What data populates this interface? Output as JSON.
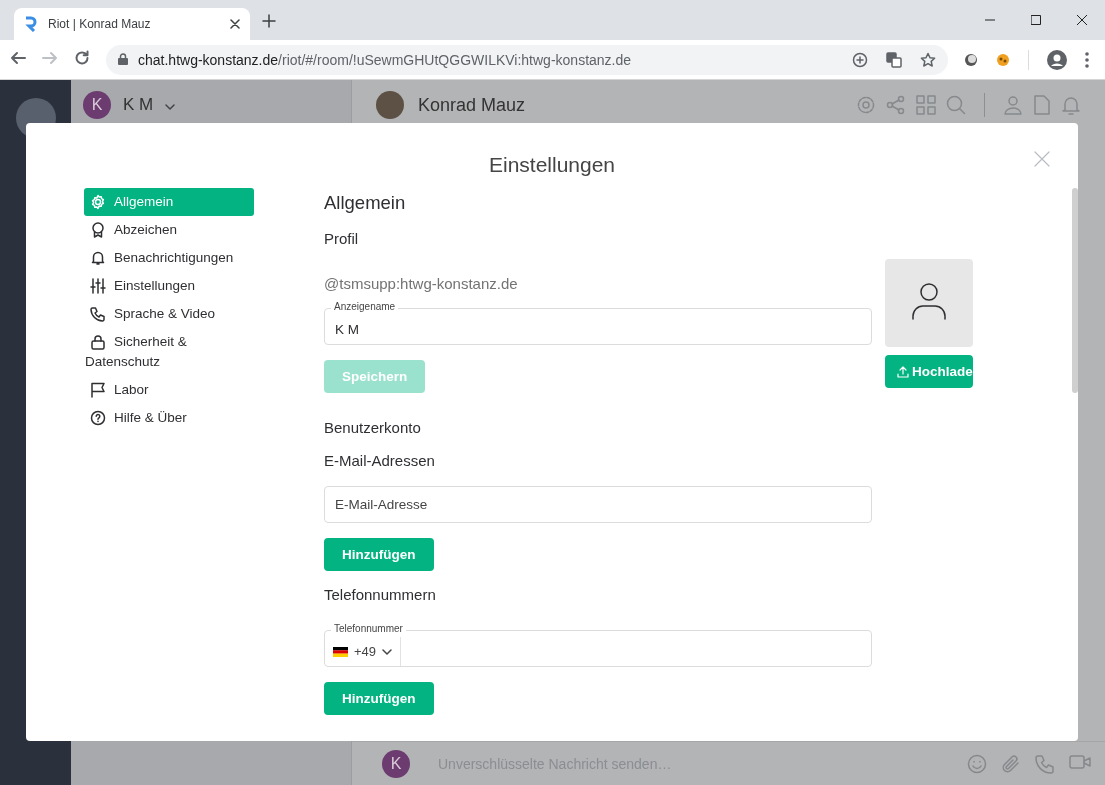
{
  "browser": {
    "tab_title": "Riot | Konrad Mauz",
    "url_host": "chat.htwg-konstanz.de",
    "url_path": "/riot/#/room/!uSewmGHUtQGGWILKVi:htwg-konstanz.de"
  },
  "app": {
    "user_menu": {
      "initial": "K",
      "name": "K M"
    },
    "room": {
      "name": "Konrad Mauz"
    },
    "composer": {
      "initial": "K",
      "placeholder": "Unverschlüsselte Nachricht senden…"
    }
  },
  "dialog": {
    "title": "Einstellungen",
    "nav": [
      {
        "label": "Allgemein",
        "selected": true
      },
      {
        "label": "Abzeichen",
        "selected": false
      },
      {
        "label": "Benachrichtigungen",
        "selected": false
      },
      {
        "label": "Einstellungen",
        "selected": false
      },
      {
        "label": "Sprache & Video",
        "selected": false
      },
      {
        "label": "Sicherheit & Datenschutz",
        "selected": false
      },
      {
        "label": "Labor",
        "selected": false
      },
      {
        "label": "Hilfe & Über",
        "selected": false
      }
    ],
    "heading": "Allgemein",
    "profile_heading": "Profil",
    "user_id": "@tsmsupp:htwg-konstanz.de",
    "display_name": {
      "label": "Anzeigename",
      "value": "K M"
    },
    "save_button": {
      "label": "Speichern",
      "disabled": true
    },
    "upload_button": {
      "label": "Hochlade"
    },
    "account_heading": "Benutzerkonto",
    "email_heading": "E-Mail-Adressen",
    "email_field": {
      "placeholder": "E-Mail-Adresse"
    },
    "email_add_button": {
      "label": "Hinzufügen"
    },
    "phone_heading": "Telefonnummern",
    "phone_field": {
      "label": "Telefonnummer",
      "country_code": "+49"
    },
    "phone_add_button": {
      "label": "Hinzufügen"
    }
  }
}
